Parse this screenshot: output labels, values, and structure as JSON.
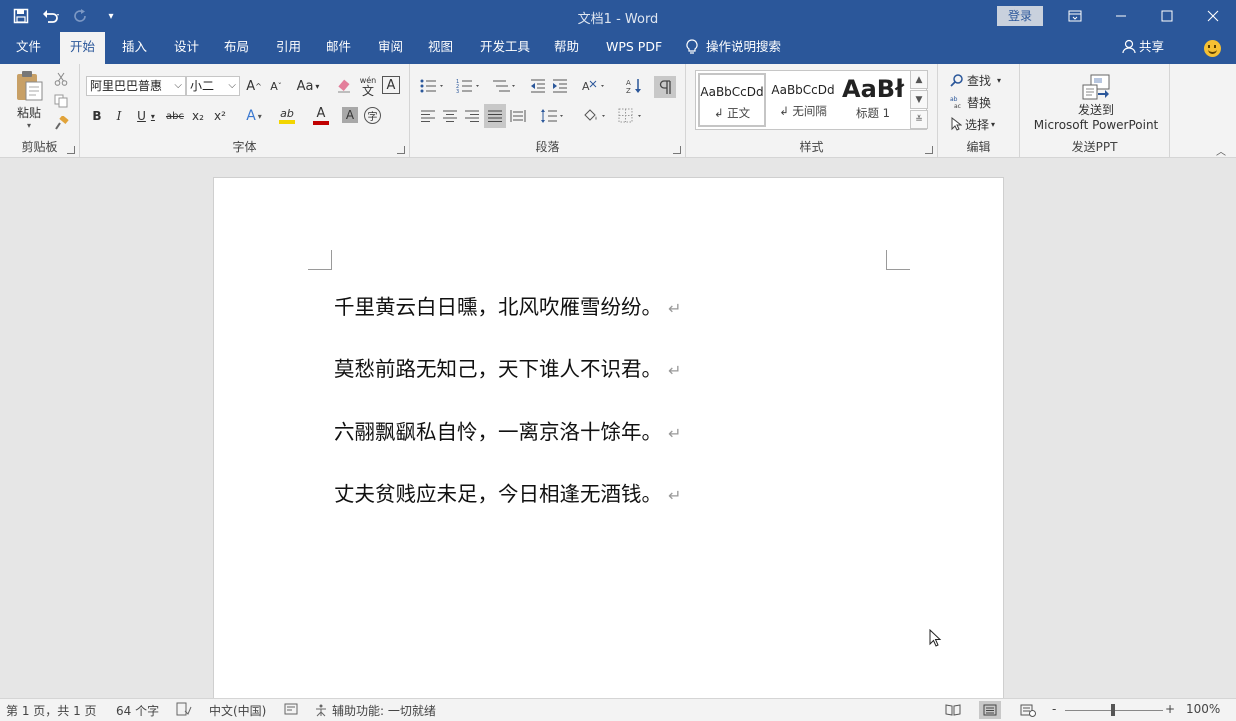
{
  "window": {
    "title": "文档1  -  Word",
    "login_label": "登录",
    "minimize": "−",
    "restore": "❐",
    "maximize": "□",
    "close": "✕",
    "ribbon_display": "⊡"
  },
  "quick_access": {
    "save": "💾",
    "undo": "↶",
    "redo": "↻",
    "customize": "▾"
  },
  "tabs": [
    {
      "label": "文件"
    },
    {
      "label": "开始",
      "active": true
    },
    {
      "label": "插入"
    },
    {
      "label": "设计"
    },
    {
      "label": "布局"
    },
    {
      "label": "引用"
    },
    {
      "label": "邮件"
    },
    {
      "label": "审阅"
    },
    {
      "label": "视图"
    },
    {
      "label": "开发工具"
    },
    {
      "label": "帮助"
    },
    {
      "label": "WPS PDF"
    }
  ],
  "tell_me": "操作说明搜索",
  "share": "共享",
  "ribbon": {
    "clipboard": {
      "label": "剪贴板",
      "paste": "粘贴"
    },
    "font": {
      "label": "字体",
      "font_name": "阿里巴巴普惠",
      "font_size": "小二",
      "grow": "A",
      "shrink": "A",
      "change_case": "Aa",
      "phonetic_top": "wén",
      "phonetic_char": "文",
      "border_char": "A",
      "bold": "B",
      "italic": "I",
      "underline": "U",
      "strike": "abc",
      "subscript": "x₂",
      "superscript": "x²",
      "text_effects": "A",
      "highlight": "ab",
      "font_color": "A",
      "char_shading": "A",
      "enclose": "字"
    },
    "paragraph": {
      "label": "段落"
    },
    "styles": {
      "label": "样式",
      "items": [
        {
          "sample": "AaBbCcDd",
          "name": "↲ 正文"
        },
        {
          "sample": "AaBbCcDd",
          "name": "↲ 无间隔"
        },
        {
          "sample": "AaBł",
          "name": "标题 1"
        }
      ]
    },
    "editing": {
      "label": "编辑",
      "find": "查找",
      "replace": "替换",
      "select": "选择"
    },
    "send_ppt": {
      "label": "发送PPT",
      "line1": "发送到",
      "line2": "Microsoft PowerPoint"
    }
  },
  "document": {
    "lines": [
      "千里黄云白日曛，北风吹雁雪纷纷。",
      "莫愁前路无知己，天下谁人不识君。",
      "六翮飘飖私自怜，一离京洛十馀年。",
      "丈夫贫贱应未足，今日相逢无酒钱。"
    ],
    "paragraph_mark": "↵"
  },
  "status": {
    "page": "第 1 页，共 1 页",
    "words": "64 个字",
    "language": "中文(中国)",
    "accessibility": "辅助功能: 一切就绪",
    "zoom_minus": "-",
    "zoom_plus": "+",
    "zoom": "100%",
    "zoom_level": 1.0
  },
  "colors": {
    "brand": "#2b579a",
    "ribbon_bg": "#f3f3f3",
    "highlight_yellow": "#f2d500",
    "font_red": "#c00000"
  }
}
